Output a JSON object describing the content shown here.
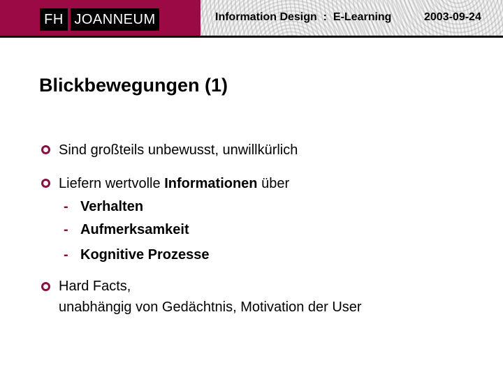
{
  "header": {
    "logo": {
      "part1": "FH",
      "part2": "JOANNEUM"
    },
    "course": "Information Design  :  E-Learning",
    "date": "2003-09-24"
  },
  "slide": {
    "title": "Blickbewegungen (1)",
    "bullets": [
      {
        "text": "Sind großteils unbewusst, unwillkürlich"
      },
      {
        "text_before": "Liefern wertvolle ",
        "text_bold": "Informationen",
        "text_after": " über",
        "subitems": [
          "Verhalten",
          "Aufmerksamkeit",
          "Kognitive Prozesse"
        ]
      },
      {
        "line1": "Hard Facts,",
        "line2": "unabhängig von Gedächtnis, Motivation der User"
      }
    ],
    "subitem_marker": "-"
  },
  "colors": {
    "brand_maroon": "#9b0a45",
    "bullet": "#8a1040"
  }
}
